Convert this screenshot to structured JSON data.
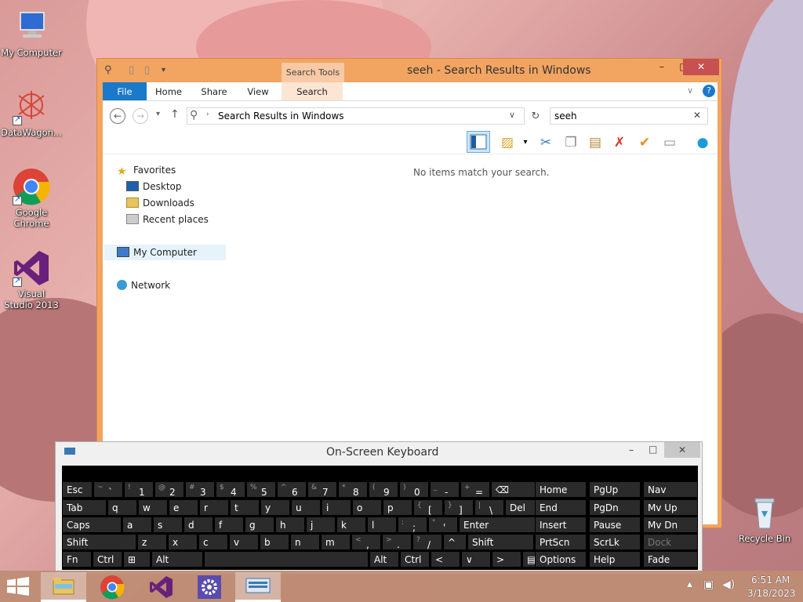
{
  "desktop": {
    "icons": [
      {
        "label": "My Computer",
        "icon": "computer-icon"
      },
      {
        "label": "DataWagon...",
        "icon": "datawagon-icon"
      },
      {
        "label": "Google Chrome",
        "icon": "chrome-icon"
      },
      {
        "label": "Visual Studio 2013",
        "icon": "visual-studio-icon"
      },
      {
        "label": "Recycle Bin",
        "icon": "recycle-bin-icon"
      }
    ]
  },
  "explorer": {
    "title": "seeh - Search Results in Windows",
    "contextual_tab_header": "Search Tools",
    "tabs": [
      "File",
      "Home",
      "Share",
      "View",
      "Search"
    ],
    "address": "Search Results in Windows",
    "search_value": "seeh",
    "empty_message": "No items match your search.",
    "nav": {
      "favorites": "Favorites",
      "desktop": "Desktop",
      "downloads": "Downloads",
      "recent": "Recent places",
      "computer": "My Computer",
      "network": "Network"
    },
    "window_buttons": {
      "minimize": "–",
      "maximize": "□",
      "close": "✕"
    }
  },
  "osk": {
    "title": "On-Screen Keyboard",
    "row1": [
      {
        "sup": "",
        "main": "Esc"
      },
      {
        "sup": "~",
        "main": "`"
      },
      {
        "sup": "!",
        "main": "1"
      },
      {
        "sup": "@",
        "main": "2"
      },
      {
        "sup": "#",
        "main": "3"
      },
      {
        "sup": "$",
        "main": "4"
      },
      {
        "sup": "%",
        "main": "5"
      },
      {
        "sup": "^",
        "main": "6"
      },
      {
        "sup": "&",
        "main": "7"
      },
      {
        "sup": "*",
        "main": "8"
      },
      {
        "sup": "(",
        "main": "9"
      },
      {
        "sup": ")",
        "main": "0"
      },
      {
        "sup": "_",
        "main": "-"
      },
      {
        "sup": "+",
        "main": "="
      },
      {
        "sup": "",
        "main": "⌫"
      }
    ],
    "row2": [
      "Tab",
      "q",
      "w",
      "e",
      "r",
      "t",
      "y",
      "u",
      "i",
      "o",
      "p",
      "[",
      "]",
      "\\",
      "Del"
    ],
    "row2_sup": [
      "",
      "",
      "",
      "",
      "",
      "",
      "",
      "",
      "",
      "",
      "",
      "{",
      "}",
      "|",
      ""
    ],
    "row3": [
      "Caps",
      "a",
      "s",
      "d",
      "f",
      "g",
      "h",
      "j",
      "k",
      "l",
      ";",
      "'",
      "Enter"
    ],
    "row3_sup": [
      "",
      "",
      "",
      "",
      "",
      "",
      "",
      "",
      "",
      "",
      ":",
      "\"",
      ""
    ],
    "row4": [
      "Shift",
      "z",
      "x",
      "c",
      "v",
      "b",
      "n",
      "m",
      ",",
      ".",
      "/",
      "^",
      "Shift"
    ],
    "row4_sup": [
      "",
      "",
      "",
      "",
      "",
      "",
      "",
      "",
      "<",
      ">",
      "?",
      "",
      ""
    ],
    "row5": [
      "Fn",
      "Ctrl",
      "⊞",
      "Alt",
      "",
      "Alt",
      "Ctrl",
      "<",
      "∨",
      ">",
      "▤"
    ],
    "nav_keys": [
      [
        "Home",
        "PgUp",
        "Nav"
      ],
      [
        "End",
        "PgDn",
        "Mv Up"
      ],
      [
        "Insert",
        "Pause",
        "Mv Dn"
      ],
      [
        "PrtScn",
        "ScrLk",
        "Dock"
      ],
      [
        "Options",
        "Help",
        "Fade"
      ]
    ]
  },
  "taskbar": {
    "time": "6:51 AM",
    "date": "3/18/2023"
  }
}
